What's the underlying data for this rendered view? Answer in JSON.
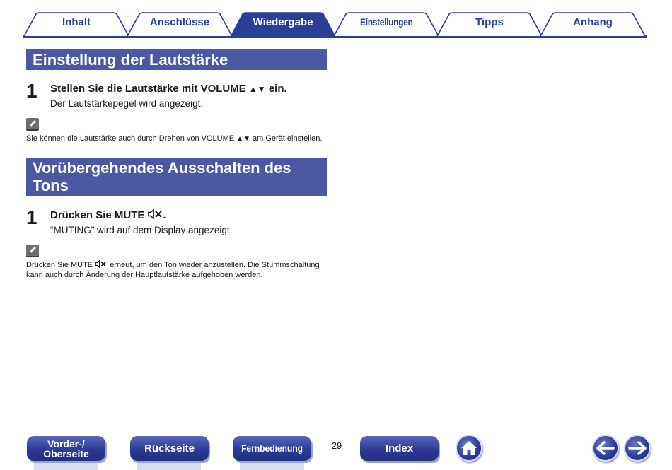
{
  "tabs": [
    {
      "label": "Inhalt",
      "active": false
    },
    {
      "label": "Anschlüsse",
      "active": false
    },
    {
      "label": "Wiedergabe",
      "active": true
    },
    {
      "label": "Einstellungen",
      "active": false
    },
    {
      "label": "Tipps",
      "active": false
    },
    {
      "label": "Anhang",
      "active": false
    }
  ],
  "section1": {
    "heading": "Einstellung der Lautstärke",
    "step_number": "1",
    "step_title_before": "Stellen Sie die Lautstärke mit VOLUME ",
    "step_title_symbol": "▲▼",
    "step_title_after": " ein.",
    "step_text": "Der Lautstärkepegel wird angezeigt.",
    "note_before": "Sie können die Lautstärke auch durch Drehen von VOLUME ",
    "note_symbol": "▲▼",
    "note_after": " am Gerät einstellen."
  },
  "section2": {
    "heading_line1": "Vorübergehendes Ausschalten des",
    "heading_line2": "Tons",
    "step_number": "1",
    "step_title_before": "Drücken Sie MUTE ",
    "step_title_after": ".",
    "step_text": "“MUTING” wird auf dem Display angezeigt.",
    "note_line1_before": "Drücken Sie MUTE ",
    "note_line1_after": " erneut, um den Ton wieder anzustellen. Die Stummschaltung",
    "note_line2": "kann auch durch Änderung der Hauptlautstärke aufgehoben werden."
  },
  "footer": {
    "buttons": {
      "front_top_line1": "Vorder-/",
      "front_top_line2": "Oberseite",
      "rear": "Rückseite",
      "remote": "Fernbedienung",
      "index": "Index"
    },
    "page_number": "29",
    "icons": [
      "home-icon",
      "arrow-left-icon",
      "arrow-right-icon"
    ]
  },
  "colors": {
    "brand_blue": "#2c3e97",
    "heading_bg": "#4d58a5"
  }
}
